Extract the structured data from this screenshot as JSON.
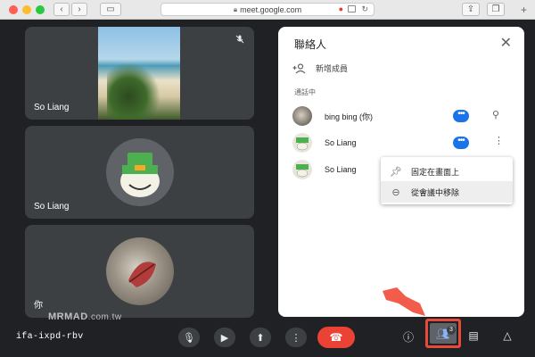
{
  "browser": {
    "url": "meet.google.com"
  },
  "tiles": [
    {
      "name": "So Liang",
      "muted": true
    },
    {
      "name": "So Liang"
    },
    {
      "name": "你"
    }
  ],
  "people_panel": {
    "title": "聯絡人",
    "add_label": "新增成員",
    "section_label": "通話中",
    "participants": [
      {
        "name": "bing bing (你)"
      },
      {
        "name": "So Liang"
      },
      {
        "name": "So Liang"
      }
    ],
    "menu": {
      "items": [
        {
          "label": "固定在畫面上",
          "icon": "pin-icon"
        },
        {
          "label": "從會議中移除",
          "icon": "remove-circle-icon"
        }
      ]
    }
  },
  "bottom_bar": {
    "meeting_code": "ifa-ixpd-rbv",
    "people_count": "3"
  },
  "watermark": {
    "brand": "MRMAD",
    "domain": ".com.tw"
  },
  "colors": {
    "accent": "#1a73e8",
    "end_call": "#ea4335",
    "highlight_box": "#e84a3a",
    "background": "#202124"
  }
}
